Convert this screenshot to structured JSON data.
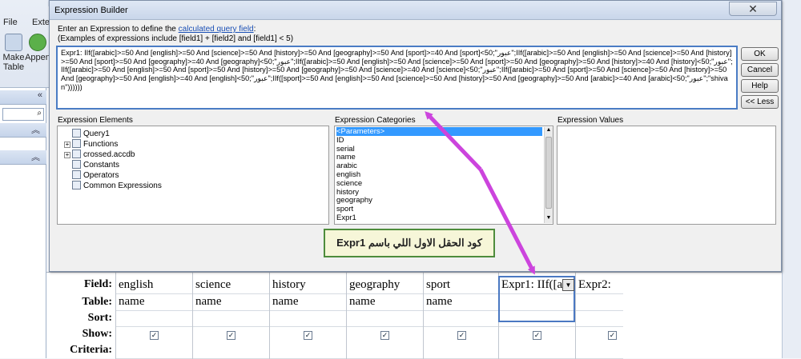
{
  "background": {
    "tabs": [
      "File",
      "Exte"
    ],
    "ribbon_buttons": [
      {
        "label": "Make\nTable",
        "icon": "make-table-icon"
      },
      {
        "label": "Appen",
        "icon": "append-icon"
      }
    ],
    "nav_arrows": "«"
  },
  "dialog": {
    "title": "Expression Builder",
    "close_glyph": "✕",
    "instruction_prefix": "Enter an Expression to define the ",
    "instruction_link": "calculated query field",
    "instruction_suffix": ":",
    "examples": "(Examples of expressions include [field1] + [field2] and [field1] < 5)",
    "expression": "Expr1: IIf([arabic]>=50 And [english]>=50 And [science]>=50 And [history]>=50 And [geography]>=50 And [sport]>=40 And [sport]<50;\"عبور\";IIf([arabic]>=50 And [english]>=50 And [science]>=50 And [history]>=50 And [sport]>=50 And [geography]>=40 And [geography]<50;\"عبور\";IIf([arabic]>=50 And [english]>=50 And [science]>=50 And [sport]>=50 And [geography]>=50 And [history]>=40 And [history]<50;\"عبور\";IIf([arabic]>=50 And [english]>=50 And [sport]>=50 And [history]>=50 And [geography]>=50 And [science]>=40 And [science]<50;\"عبور\";IIf([arabic]>=50 And [sport]>=50 And [science]>=50 And [history]>=50 And [geography]>=50 And [english]>=40 And [english]<50;\"عبور\";IIf([sport]>=50 And [english]>=50 And [science]>=50 And [history]>=50 And [geography]>=50 And [arabic]>=40 And [arabic]<50;\"عبور\";\"shivan\"))))))",
    "buttons": {
      "ok": "OK",
      "cancel": "Cancel",
      "help": "Help",
      "less": "<< Less"
    },
    "elements_label": "Expression Elements",
    "categories_label": "Expression Categories",
    "values_label": "Expression Values",
    "elements": [
      {
        "label": "Query1",
        "icon": "query-icon",
        "expand": ""
      },
      {
        "label": "Functions",
        "icon": "functions-icon",
        "expand": "+"
      },
      {
        "label": "crossed.accdb",
        "icon": "database-icon",
        "expand": "+"
      },
      {
        "label": "Constants",
        "icon": "constants-icon",
        "expand": ""
      },
      {
        "label": "Operators",
        "icon": "operators-icon",
        "expand": ""
      },
      {
        "label": "Common Expressions",
        "icon": "common-expressions-icon",
        "expand": ""
      }
    ],
    "categories": [
      "<Parameters>",
      "ID",
      "serial",
      "name",
      "arabic",
      "english",
      "science",
      "history",
      "geography",
      "sport",
      "Expr1"
    ],
    "selected_category": "<Parameters>"
  },
  "callout": {
    "text": "كود الحقل الاول اللي باسم Expr1"
  },
  "grid": {
    "row_labels": [
      "Field:",
      "Table:",
      "Sort:",
      "Show:",
      "Criteria:"
    ],
    "columns": [
      {
        "field": "english",
        "table": "name",
        "show": true
      },
      {
        "field": "science",
        "table": "name",
        "show": true
      },
      {
        "field": "history",
        "table": "name",
        "show": true
      },
      {
        "field": "geography",
        "table": "name",
        "show": true
      },
      {
        "field": "sport",
        "table": "name",
        "show": true
      },
      {
        "field": "Expr1: IIf([a",
        "table": "",
        "show": true
      },
      {
        "field": "Expr2:",
        "table": "",
        "show": true
      }
    ],
    "check_glyph": "✓"
  },
  "colors": {
    "highlight": "#4a7cc4",
    "arrow": "#cc44dd",
    "callout_border": "#4e8c3c",
    "selection": "#3399ff"
  }
}
